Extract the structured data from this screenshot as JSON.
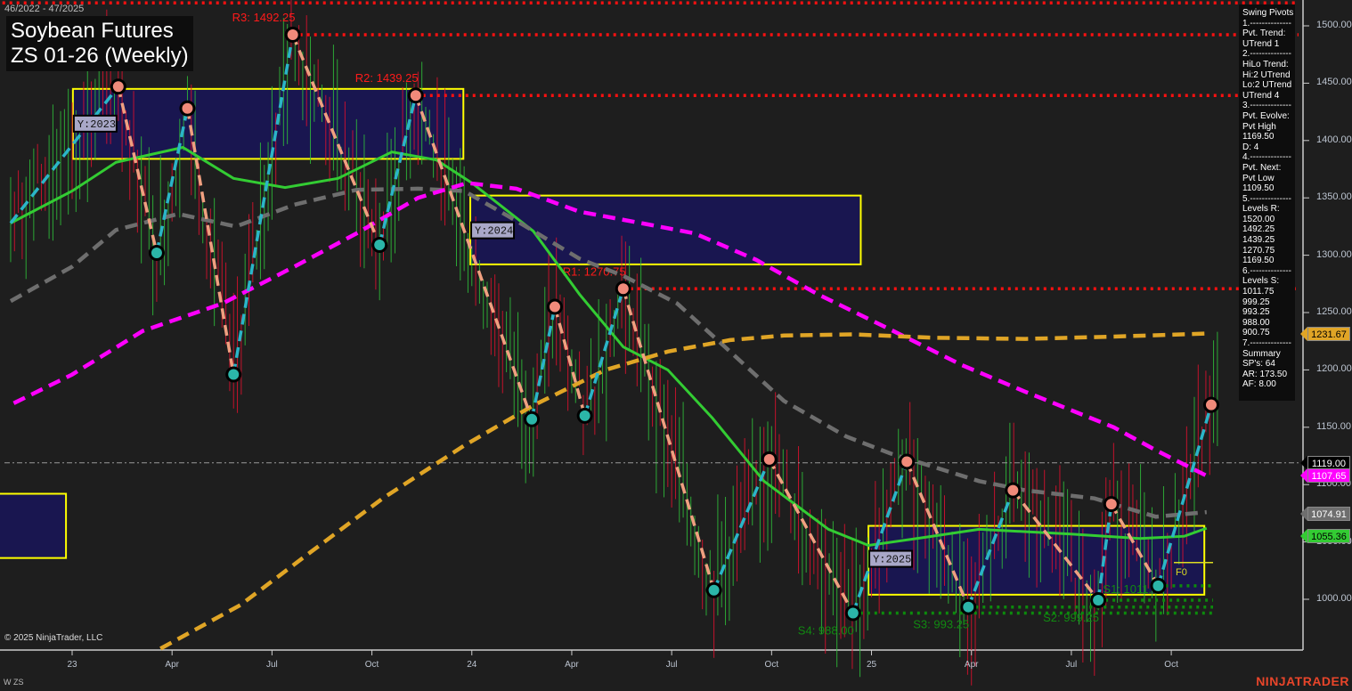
{
  "header": {
    "date_range": "46/2022 - 47/2025",
    "title_line1": "Soybean Futures",
    "title_line2": "ZS 01-26 (Weekly)"
  },
  "panel": {
    "lines": [
      "Swing Pivots",
      "1.--------------",
      "Pvt. Trend:",
      "UTrend 1",
      "2.--------------",
      "HiLo Trend:",
      "Hi:2 UTrend",
      "Lo:2 UTrend",
      "UTrend 4",
      "3.--------------",
      "Pvt. Evolve:",
      "Pvt High",
      "1169.50",
      "D: 4",
      "4.--------------",
      "Pvt. Next:",
      "Pvt Low",
      "1109.50",
      "5.--------------",
      "Levels R:",
      "1520.00",
      "1492.25",
      "1439.25",
      "1270.75",
      "1169.50",
      "6.--------------",
      "Levels S:",
      "1011.75",
      "999.25",
      "993.25",
      "988.00",
      "900.75",
      "7.--------------",
      "Summary",
      "SP's: 64",
      "AR: 173.50",
      "AF: 8.00"
    ]
  },
  "price_axis": {
    "ticks": [
      "1500.00",
      "1450.00",
      "1400.00",
      "1350.00",
      "1300.00",
      "1250.00",
      "1200.00",
      "1150.00",
      "1100.00",
      "1050.00",
      "1000.00"
    ],
    "tick_values": [
      1500,
      1450,
      1400,
      1350,
      1300,
      1250,
      1200,
      1150,
      1100,
      1050,
      1000
    ]
  },
  "time_axis": {
    "labels": [
      "23",
      "Apr",
      "Jul",
      "Oct",
      "24",
      "Apr",
      "Jul",
      "Oct",
      "25",
      "Apr",
      "Jul",
      "Oct"
    ],
    "weeks": [
      0,
      13,
      26,
      39,
      52,
      65,
      78,
      91,
      104,
      117,
      130,
      143
    ]
  },
  "price_tags": [
    {
      "label": "1231.67",
      "value": 1231.67,
      "bg": "#e0a526",
      "fg": "#000"
    },
    {
      "label": "1119.00",
      "value": 1119.0,
      "bg": "#000000",
      "fg": "#fff"
    },
    {
      "label": "1107.65",
      "value": 1107.65,
      "bg": "#ff00ff",
      "fg": "#fff"
    },
    {
      "label": "1074.91",
      "value": 1074.91,
      "bg": "#6e6e6e",
      "fg": "#fff"
    },
    {
      "label": "1055.36",
      "value": 1055.36,
      "bg": "#33cc33",
      "fg": "#000"
    }
  ],
  "levels": {
    "resistance": [
      {
        "label": "",
        "value": 1520.0,
        "from_week": -10
      },
      {
        "label": "R3: 1492.25",
        "value": 1492.25,
        "from_week": 28.7
      },
      {
        "label": "R2: 1439.25",
        "value": 1439.25,
        "from_week": 44.7
      },
      {
        "label": "R1: 1270.75",
        "value": 1270.75,
        "from_week": 71.7
      }
    ],
    "support": [
      {
        "label": "S4: 988.00",
        "value": 988.0,
        "from_week": 101.6
      },
      {
        "label": "S3: 993.25",
        "value": 993.25,
        "from_week": 116.6
      },
      {
        "label": "S2: 999.25",
        "value": 999.25,
        "from_week": 133.5
      },
      {
        "label": "S1: 1011.75",
        "value": 1011.75,
        "from_week": 141.3
      }
    ],
    "last_price": 1119.0,
    "f0_label": "F0",
    "f0_value": 1032
  },
  "year_boxes": [
    {
      "label": "",
      "w0": -12,
      "w1": -0.8,
      "hi": 1092,
      "lo": 1036
    },
    {
      "label": "Y:2023",
      "w0": 0.1,
      "w1": 50.9,
      "hi": 1445,
      "lo": 1384
    },
    {
      "label": "Y:2024",
      "w0": 51.8,
      "w1": 102.6,
      "hi": 1352,
      "lo": 1292
    },
    {
      "label": "Y:2025",
      "w0": 103.6,
      "w1": 147.3,
      "hi": 1064,
      "lo": 1004
    }
  ],
  "pivots": [
    [
      -8,
      1328,
      "L"
    ],
    [
      6,
      1447,
      "H"
    ],
    [
      11,
      1302,
      "L"
    ],
    [
      15,
      1428,
      "H"
    ],
    [
      21,
      1196,
      "L"
    ],
    [
      28.7,
      1492.25,
      "H"
    ],
    [
      40,
      1309,
      "L"
    ],
    [
      44.7,
      1439.25,
      "H"
    ],
    [
      59.8,
      1157,
      "L"
    ],
    [
      62.8,
      1255,
      "H"
    ],
    [
      66.7,
      1160,
      "L"
    ],
    [
      71.7,
      1270.75,
      "H"
    ],
    [
      83.5,
      1008,
      "L"
    ],
    [
      90.7,
      1122,
      "H"
    ],
    [
      101.6,
      988,
      "L"
    ],
    [
      108.6,
      1120,
      "H"
    ],
    [
      116.6,
      993.25,
      "L"
    ],
    [
      122.4,
      1095,
      "H"
    ],
    [
      133.5,
      999.25,
      "L"
    ],
    [
      135.2,
      1083,
      "H"
    ],
    [
      141.3,
      1011.75,
      "L"
    ],
    [
      148.2,
      1169.5,
      "H"
    ]
  ],
  "moving_averages": [
    {
      "name": "green",
      "color": "#33cc33",
      "dashed": false,
      "points": [
        [
          -8,
          1328
        ],
        [
          0,
          1356
        ],
        [
          5.7,
          1381
        ],
        [
          14.4,
          1394
        ],
        [
          21,
          1367
        ],
        [
          27.7,
          1359
        ],
        [
          34.6,
          1367
        ],
        [
          41.6,
          1390
        ],
        [
          47.4,
          1383
        ],
        [
          52,
          1363
        ],
        [
          60,
          1321
        ],
        [
          66,
          1266
        ],
        [
          71.7,
          1220
        ],
        [
          77.5,
          1200
        ],
        [
          83.3,
          1158
        ],
        [
          90,
          1103
        ],
        [
          98.4,
          1061
        ],
        [
          103.6,
          1047
        ],
        [
          111,
          1054
        ],
        [
          118,
          1061
        ],
        [
          129.7,
          1057
        ],
        [
          138.9,
          1053
        ],
        [
          144.7,
          1055
        ],
        [
          147.6,
          1062
        ]
      ]
    },
    {
      "name": "gray",
      "color": "#6e6e6e",
      "dashed": true,
      "points": [
        [
          -8,
          1260
        ],
        [
          0,
          1290
        ],
        [
          5.7,
          1322
        ],
        [
          13.8,
          1336
        ],
        [
          21.3,
          1325
        ],
        [
          28.9,
          1344
        ],
        [
          37,
          1357
        ],
        [
          45,
          1358
        ],
        [
          51,
          1356
        ],
        [
          57.8,
          1330
        ],
        [
          66,
          1297
        ],
        [
          71.7,
          1282
        ],
        [
          78.7,
          1258
        ],
        [
          85.6,
          1216
        ],
        [
          92.6,
          1173
        ],
        [
          100.7,
          1142
        ],
        [
          106.5,
          1127
        ],
        [
          112.3,
          1115
        ],
        [
          118,
          1103
        ],
        [
          124,
          1095
        ],
        [
          133,
          1088
        ],
        [
          141,
          1072
        ],
        [
          147.6,
          1076
        ]
      ]
    },
    {
      "name": "magenta",
      "color": "#ff00ff",
      "dashed": true,
      "points": [
        [
          -7.6,
          1171
        ],
        [
          0,
          1196
        ],
        [
          9.2,
          1234
        ],
        [
          19.6,
          1258
        ],
        [
          28.9,
          1290
        ],
        [
          37,
          1319
        ],
        [
          45,
          1350
        ],
        [
          51.4,
          1363
        ],
        [
          57.8,
          1358
        ],
        [
          66,
          1338
        ],
        [
          74,
          1328
        ],
        [
          81,
          1319
        ],
        [
          89,
          1296
        ],
        [
          97,
          1266
        ],
        [
          106.5,
          1235
        ],
        [
          115.8,
          1204
        ],
        [
          124,
          1181
        ],
        [
          135.5,
          1150
        ],
        [
          141,
          1130
        ],
        [
          147.6,
          1107.65
        ]
      ]
    },
    {
      "name": "gold",
      "color": "#e0a526",
      "dashed": true,
      "points": [
        [
          11.5,
          957
        ],
        [
          21.9,
          995
        ],
        [
          31,
          1041
        ],
        [
          40.4,
          1088
        ],
        [
          51,
          1134
        ],
        [
          60,
          1169
        ],
        [
          69.4,
          1200
        ],
        [
          77.5,
          1216
        ],
        [
          85.6,
          1226
        ],
        [
          92.6,
          1230
        ],
        [
          101.8,
          1231
        ],
        [
          112,
          1228
        ],
        [
          124,
          1227
        ],
        [
          135.5,
          1229
        ],
        [
          147.6,
          1231.67
        ]
      ]
    }
  ],
  "footer": {
    "copyright": "© 2025 NinjaTrader, LLC",
    "symbol": "W ZS",
    "brand": "NINJATRADER"
  }
}
